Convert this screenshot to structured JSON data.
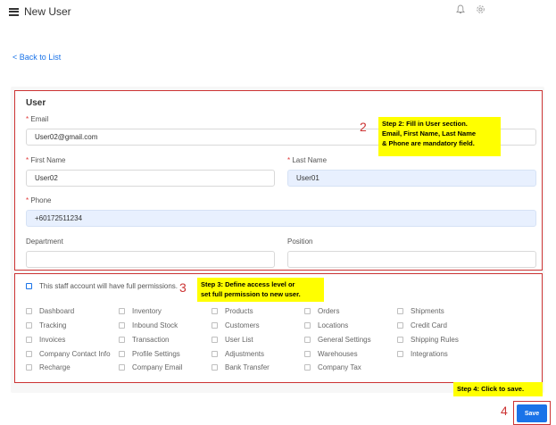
{
  "header": {
    "title": "New User",
    "icons": [
      "bell-icon",
      "gear-icon"
    ]
  },
  "back_link": "< Back to List",
  "user_section": {
    "title": "User",
    "email": {
      "label": "Email",
      "required": "*",
      "value": "User02@gmail.com"
    },
    "first_name": {
      "label": "First Name",
      "required": "*",
      "value": "User02"
    },
    "last_name": {
      "label": "Last Name",
      "required": "*",
      "value": "User01"
    },
    "phone": {
      "label": "Phone",
      "required": "*",
      "value": "+60172511234"
    },
    "department": {
      "label": "Department",
      "value": ""
    },
    "position": {
      "label": "Position",
      "value": ""
    }
  },
  "permissions": {
    "full_permission_label": "This staff account will have full permissions.",
    "columns": [
      [
        "Dashboard",
        "Tracking",
        "Invoices",
        "Company Contact Info",
        "Recharge"
      ],
      [
        "Inventory",
        "Inbound Stock",
        "Transaction",
        "Profile Settings",
        "Company Email"
      ],
      [
        "Products",
        "Customers",
        "User List",
        "Adjustments",
        "Bank Transfer"
      ],
      [
        "Orders",
        "Locations",
        "General Settings",
        "Warehouses",
        "Company Tax"
      ],
      [
        "Shipments",
        "Credit Card",
        "Shipping Rules",
        "Integrations"
      ]
    ]
  },
  "annotations": {
    "step2_num": "2",
    "step2_line1": "Step 2: Fill in User section.",
    "step2_line2": "Email, First Name, Last Name",
    "step2_line3": "& Phone are mandatory field.",
    "step3_num": "3",
    "step3_line1": "Step 3: Define access level or",
    "step3_line2": "set full permission to new user.",
    "step4_num": "4",
    "step4_text": "Step 4: Click to save."
  },
  "save_label": "Save",
  "colors": {
    "accent": "#1a73e8",
    "annotation_border": "#cc3333",
    "highlight": "#ffff00"
  }
}
